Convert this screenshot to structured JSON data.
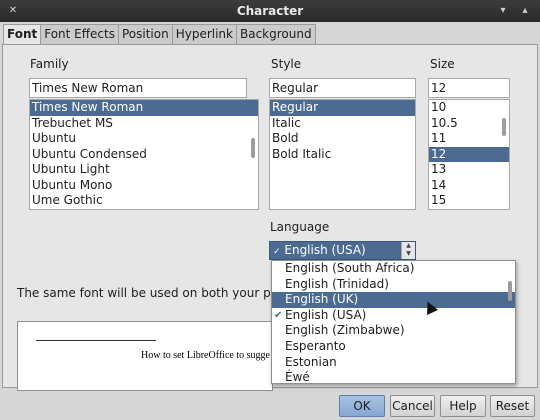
{
  "window": {
    "title": "Character"
  },
  "tabs": [
    "Font",
    "Font Effects",
    "Position",
    "Hyperlink",
    "Background"
  ],
  "font_panel": {
    "family": {
      "label": "Family",
      "value": "Times New Roman",
      "items": [
        "Times New Roman",
        "Trebuchet MS",
        "Ubuntu",
        "Ubuntu Condensed",
        "Ubuntu Light",
        "Ubuntu Mono",
        "Ume Gothic"
      ],
      "selected_index": 0
    },
    "style": {
      "label": "Style",
      "value": "Regular",
      "items": [
        "Regular",
        "Italic",
        "Bold",
        "Bold Italic"
      ],
      "selected_index": 0
    },
    "size": {
      "label": "Size",
      "value": "12",
      "items": [
        "10",
        "10.5",
        "11",
        "12",
        "13",
        "14",
        "15"
      ],
      "selected_index": 3
    },
    "language": {
      "label": "Language",
      "value": "English (USA)",
      "options": [
        "English (South Africa)",
        "English (Trinidad)",
        "English (UK)",
        "English (USA)",
        "English (Zimbabwe)",
        "Esperanto",
        "Estonian",
        "Éwé"
      ],
      "highlighted_index": 2,
      "checked_index": 3
    },
    "notice": "The same font will be used on both your printer",
    "preview_text": "How to set LibreOffice to sugge"
  },
  "buttons": {
    "ok": "OK",
    "cancel": "Cancel",
    "help": "Help",
    "reset": "Reset"
  }
}
